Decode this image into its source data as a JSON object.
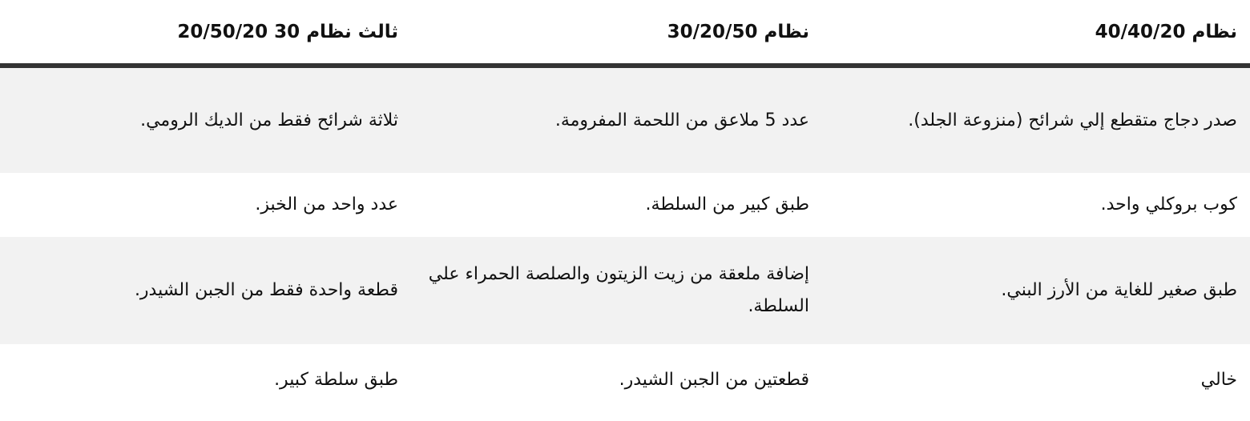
{
  "table": {
    "headers": [
      "نظام 40/40/20",
      "نظام 30/20/50",
      "ثالث نظام 30 20/50/20"
    ],
    "rows": [
      [
        "صدر دجاج متقطع إلي شرائح (منزوعة الجلد).",
        "عدد 5 ملاعق من اللحمة المفرومة.",
        "ثلاثة شرائح فقط من الديك الرومي."
      ],
      [
        "كوب بروكلي واحد.",
        "طبق كبير من السلطة.",
        "عدد واحد من الخبز."
      ],
      [
        "طبق صغير للغاية من الأرز البني.",
        "إضافة ملعقة من زيت الزيتون والصلصة الحمراء علي السلطة.",
        "قطعة واحدة فقط من الجبن الشيدر."
      ],
      [
        "خالي",
        "قطعتين من الجبن الشيدر.",
        "طبق سلطة كبير."
      ]
    ]
  }
}
